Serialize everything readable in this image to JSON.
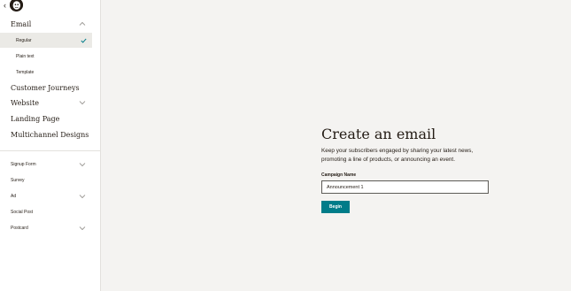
{
  "sidebar": {
    "email": {
      "label": "Email",
      "items": [
        {
          "label": "Regular"
        },
        {
          "label": "Plain text"
        },
        {
          "label": "Template"
        }
      ]
    },
    "main_items": [
      {
        "label": "Customer Journeys"
      },
      {
        "label": "Website"
      },
      {
        "label": "Landing Page"
      },
      {
        "label": "Multichannel Designs"
      }
    ],
    "tool_items": [
      {
        "label": "Signup Form"
      },
      {
        "label": "Survey"
      },
      {
        "label": "Ad"
      },
      {
        "label": "Social Post"
      },
      {
        "label": "Postcard"
      }
    ]
  },
  "main": {
    "title": "Create an email",
    "description": "Keep your subscribers engaged by sharing your latest news, promoting a line of products, or announcing an event.",
    "campaign_label": "Campaign Name",
    "campaign_value": "Announcement 1",
    "begin_label": "Begin"
  },
  "colors": {
    "accent": "#007c89",
    "check": "#007c89",
    "background": "#f4f3f1",
    "sidebar_selected": "#ebeae6"
  },
  "icons": [
    "back-arrow-icon",
    "mailchimp-logo",
    "chevron-up-icon",
    "chevron-down-icon",
    "checkmark-icon"
  ]
}
